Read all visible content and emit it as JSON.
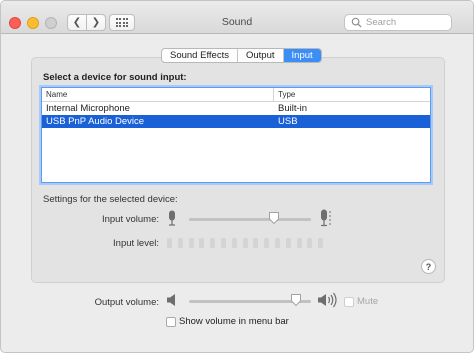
{
  "window": {
    "title": "Sound"
  },
  "search": {
    "placeholder": "Search"
  },
  "tabs": [
    {
      "label": "Sound Effects",
      "active": false
    },
    {
      "label": "Output",
      "active": false
    },
    {
      "label": "Input",
      "active": true
    }
  ],
  "input": {
    "section_label": "Select a device for sound input:",
    "table": {
      "columns": [
        "Name",
        "Type"
      ],
      "rows": [
        {
          "name": "Internal Microphone",
          "type": "Built-in",
          "selected": false
        },
        {
          "name": "USB PnP Audio Device",
          "type": "USB",
          "selected": true
        }
      ]
    },
    "settings_label": "Settings for the selected device:",
    "volume_label": "Input volume:",
    "volume_value": 0.7,
    "level_label": "Input level:",
    "level_value": 0
  },
  "output": {
    "volume_label": "Output volume:",
    "volume_value": 0.88,
    "mute_label": "Mute",
    "mute_checked": false,
    "menubar_label": "Show volume in menu bar",
    "menubar_checked": false
  },
  "help_label": "?",
  "colors": {
    "accent": "#3a8ef6",
    "selection": "#1a61d8"
  }
}
